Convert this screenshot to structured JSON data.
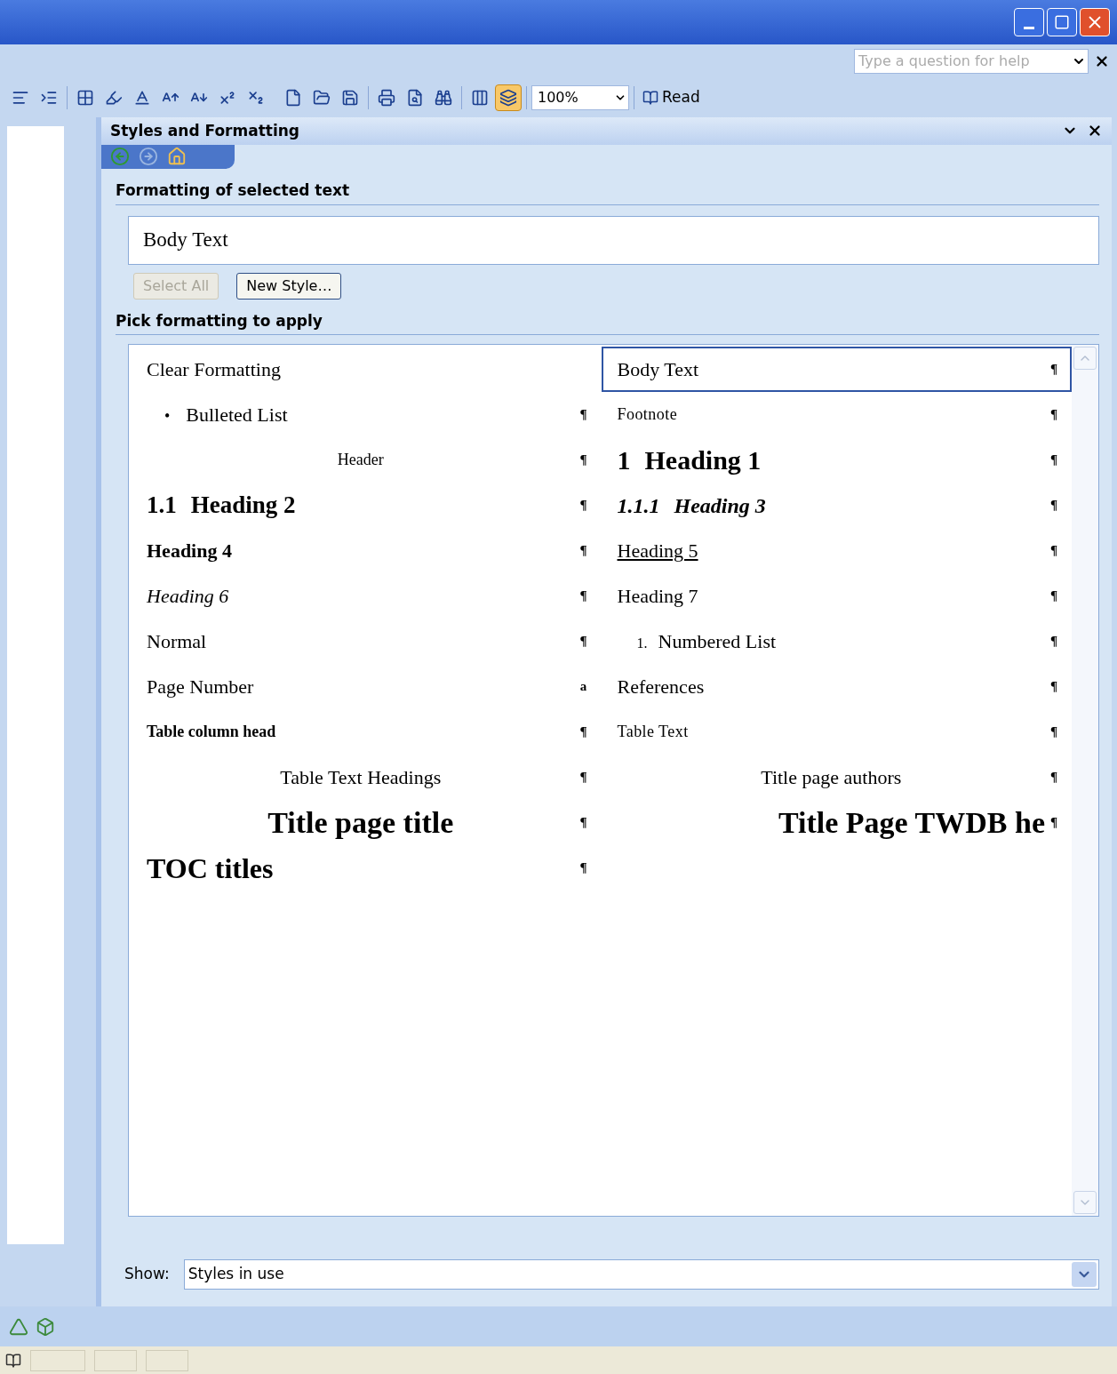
{
  "window": {
    "help_placeholder": "Type a question for help"
  },
  "toolbar": {
    "zoom": "100%",
    "read_button": "Read"
  },
  "task_pane": {
    "title": "Styles and Formatting",
    "selected_section_title": "Formatting of selected text",
    "selected_style": "Body Text",
    "buttons": [
      {
        "label": "Select All",
        "disabled": true
      },
      {
        "label": "New Style…",
        "disabled": false
      }
    ],
    "pick_title": "Pick formatting to apply",
    "styles": [
      {
        "label": "Clear Formatting",
        "kind": "plain",
        "selected": false
      },
      {
        "label": "Body Text",
        "kind": "plain",
        "mark": "¶",
        "selected": true
      },
      {
        "label": "Bulleted List",
        "kind": "bullet",
        "number": "•",
        "mark": "¶",
        "selected": false
      },
      {
        "label": "Footnote",
        "kind": "small",
        "mark": "¶",
        "selected": false
      },
      {
        "label": "Header",
        "kind": "centered-small",
        "mark": "¶",
        "selected": false
      },
      {
        "label": "Heading 1",
        "kind": "h1",
        "number": "1",
        "mark": "¶",
        "selected": false
      },
      {
        "label": "Heading 2",
        "kind": "h2",
        "number": "1.1",
        "mark": "¶",
        "selected": false
      },
      {
        "label": "Heading 3",
        "kind": "h3",
        "number": "1.1.1",
        "mark": "¶",
        "selected": false
      },
      {
        "label": "Heading 4",
        "kind": "h4",
        "mark": "¶",
        "selected": false
      },
      {
        "label": "Heading 5",
        "kind": "h5",
        "mark": "¶",
        "selected": false
      },
      {
        "label": "Heading 6",
        "kind": "h6",
        "mark": "¶",
        "selected": false
      },
      {
        "label": "Heading 7",
        "kind": "plain",
        "mark": "¶",
        "selected": false
      },
      {
        "label": "Normal",
        "kind": "plain",
        "mark": "¶",
        "selected": false
      },
      {
        "label": "Numbered List",
        "kind": "numbered",
        "number": "1.",
        "mark": "¶",
        "selected": false
      },
      {
        "label": "Page Number",
        "kind": "plain",
        "mark": "a",
        "selected": false
      },
      {
        "label": "References",
        "kind": "plain",
        "mark": "¶",
        "selected": false
      },
      {
        "label": "Table column head",
        "kind": "small-bold",
        "mark": "¶",
        "selected": false
      },
      {
        "label": "Table Text",
        "kind": "small",
        "mark": "¶",
        "selected": false
      },
      {
        "label": "Table Text Headings",
        "kind": "centered",
        "mark": "¶",
        "selected": false
      },
      {
        "label": "Title page authors",
        "kind": "centered",
        "mark": "¶",
        "selected": false
      },
      {
        "label": "Title page title",
        "kind": "title",
        "mark": "¶",
        "selected": false
      },
      {
        "label": "Title Page TWDB he",
        "kind": "title-end",
        "mark": "¶",
        "selected": false
      },
      {
        "label": "TOC titles",
        "kind": "toc",
        "mark": "¶",
        "selected": false
      }
    ],
    "show_label": "Show:",
    "show_value": "Styles in use"
  }
}
